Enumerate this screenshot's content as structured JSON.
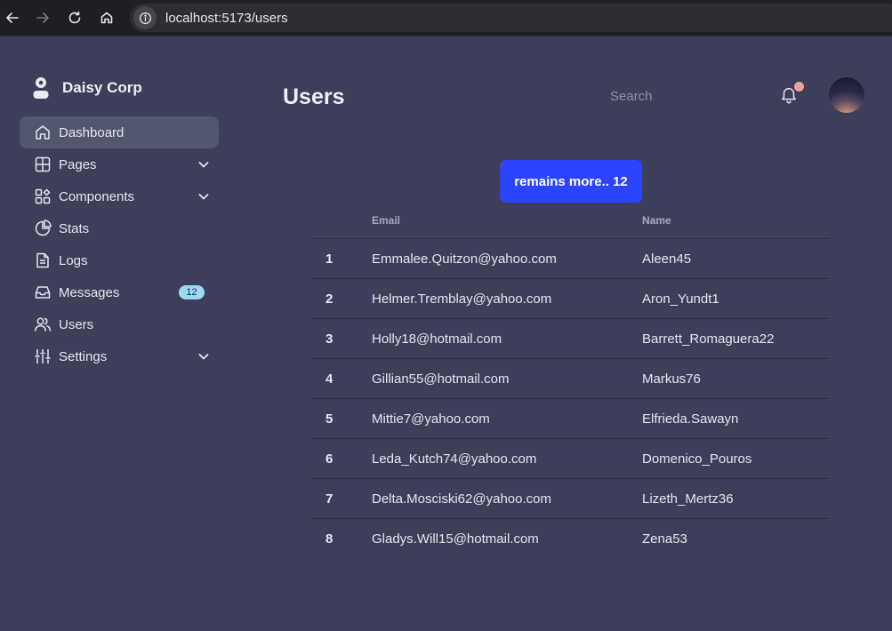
{
  "browser": {
    "url": "localhost:5173/users"
  },
  "sidebar": {
    "brand": "Daisy Corp",
    "items": [
      {
        "label": "Dashboard",
        "icon": "home-icon",
        "active": true
      },
      {
        "label": "Pages",
        "icon": "grid-icon",
        "has_submenu": true
      },
      {
        "label": "Components",
        "icon": "components-icon",
        "has_submenu": true
      },
      {
        "label": "Stats",
        "icon": "pie-chart-icon"
      },
      {
        "label": "Logs",
        "icon": "document-icon"
      },
      {
        "label": "Messages",
        "icon": "inbox-icon",
        "badge": "12"
      },
      {
        "label": "Users",
        "icon": "users-icon"
      },
      {
        "label": "Settings",
        "icon": "sliders-icon",
        "has_submenu": true
      }
    ]
  },
  "header": {
    "title": "Users",
    "search_placeholder": "Search"
  },
  "main": {
    "remains_button": "remains more.. 12",
    "table": {
      "columns": [
        "Email",
        "Name"
      ],
      "rows": [
        {
          "index": "1",
          "email": "Emmalee.Quitzon@yahoo.com",
          "name": "Aleen45"
        },
        {
          "index": "2",
          "email": "Helmer.Tremblay@yahoo.com",
          "name": "Aron_Yundt1"
        },
        {
          "index": "3",
          "email": "Holly18@hotmail.com",
          "name": "Barrett_Romaguera22"
        },
        {
          "index": "4",
          "email": "Gillian55@hotmail.com",
          "name": "Markus76"
        },
        {
          "index": "5",
          "email": "Mittie7@yahoo.com",
          "name": "Elfrieda.Sawayn"
        },
        {
          "index": "6",
          "email": "Leda_Kutch74@yahoo.com",
          "name": "Domenico_Pouros"
        },
        {
          "index": "7",
          "email": "Delta.Mosciski62@yahoo.com",
          "name": "Lizeth_Mertz36"
        },
        {
          "index": "8",
          "email": "Gladys.Will15@hotmail.com",
          "name": "Zena53"
        }
      ]
    }
  },
  "colors": {
    "background": "#3d3f5a",
    "active_item": "#53566f",
    "primary_button": "#2a44ff",
    "badge": "#9fd8f4",
    "notification_dot": "#f2a09a"
  }
}
